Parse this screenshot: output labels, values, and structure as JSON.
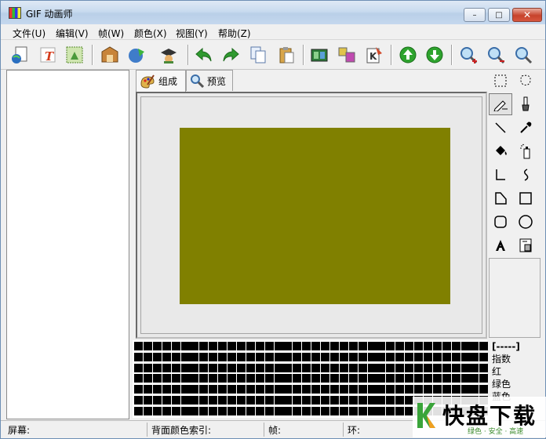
{
  "window": {
    "title": "GIF 动画师"
  },
  "titlebar_buttons": {
    "minimize": "–",
    "maximize": "□",
    "close": "✕"
  },
  "menu": [
    "文件(U)",
    "编辑(V)",
    "帧(W)",
    "颜色(X)",
    "视图(Y)",
    "帮助(Z)"
  ],
  "toolbar_icons": [
    "new-animation-icon",
    "text-icon",
    "image-frame-icon",
    "open-icon",
    "save-icon",
    "graduate-icon",
    "undo-icon",
    "redo-icon",
    "copy-icon",
    "paste-icon",
    "film-icon",
    "frame-manager-icon",
    "keyframe-icon",
    "move-up-icon",
    "move-down-icon",
    "zoom-in-icon",
    "zoom-out-icon",
    "zoom-fit-icon"
  ],
  "tabs": [
    {
      "label": "组成",
      "icon": "palette-icon",
      "active": true
    },
    {
      "label": "预览",
      "icon": "magnifier-icon",
      "active": false
    }
  ],
  "canvas": {
    "fill_color": "#808000",
    "background": "#e9e9e9"
  },
  "tools": [
    "rect-select-icon",
    "lasso-select-icon",
    "pencil-icon",
    "brush-icon",
    "line-icon",
    "eyedropper-icon",
    "fill-bucket-icon",
    "spray-icon",
    "polyline-icon",
    "curve-icon",
    "polygon-icon",
    "rectangle-icon",
    "rounded-rect-icon",
    "ellipse-icon",
    "text-tool-icon",
    "transparent-color-icon"
  ],
  "palette": {
    "columns": 38,
    "rows": 7,
    "color": "#000000"
  },
  "color_info": {
    "index_label": "[-----]",
    "index_text": "指数",
    "red_text": "红",
    "green_text": "绿色",
    "blue_text": "蓝色"
  },
  "status": {
    "screen": "屏幕:",
    "bg_index": "背面颜色索引:",
    "frame": "帧:",
    "loop": "环:"
  },
  "watermark": {
    "brand": "快盘下载",
    "tagline": "绿色 · 安全 · 高速"
  },
  "colors": {
    "accent_green": "#3aa43a",
    "title_gradient_top": "#dfe9f5",
    "close_red": "#c7432c"
  }
}
